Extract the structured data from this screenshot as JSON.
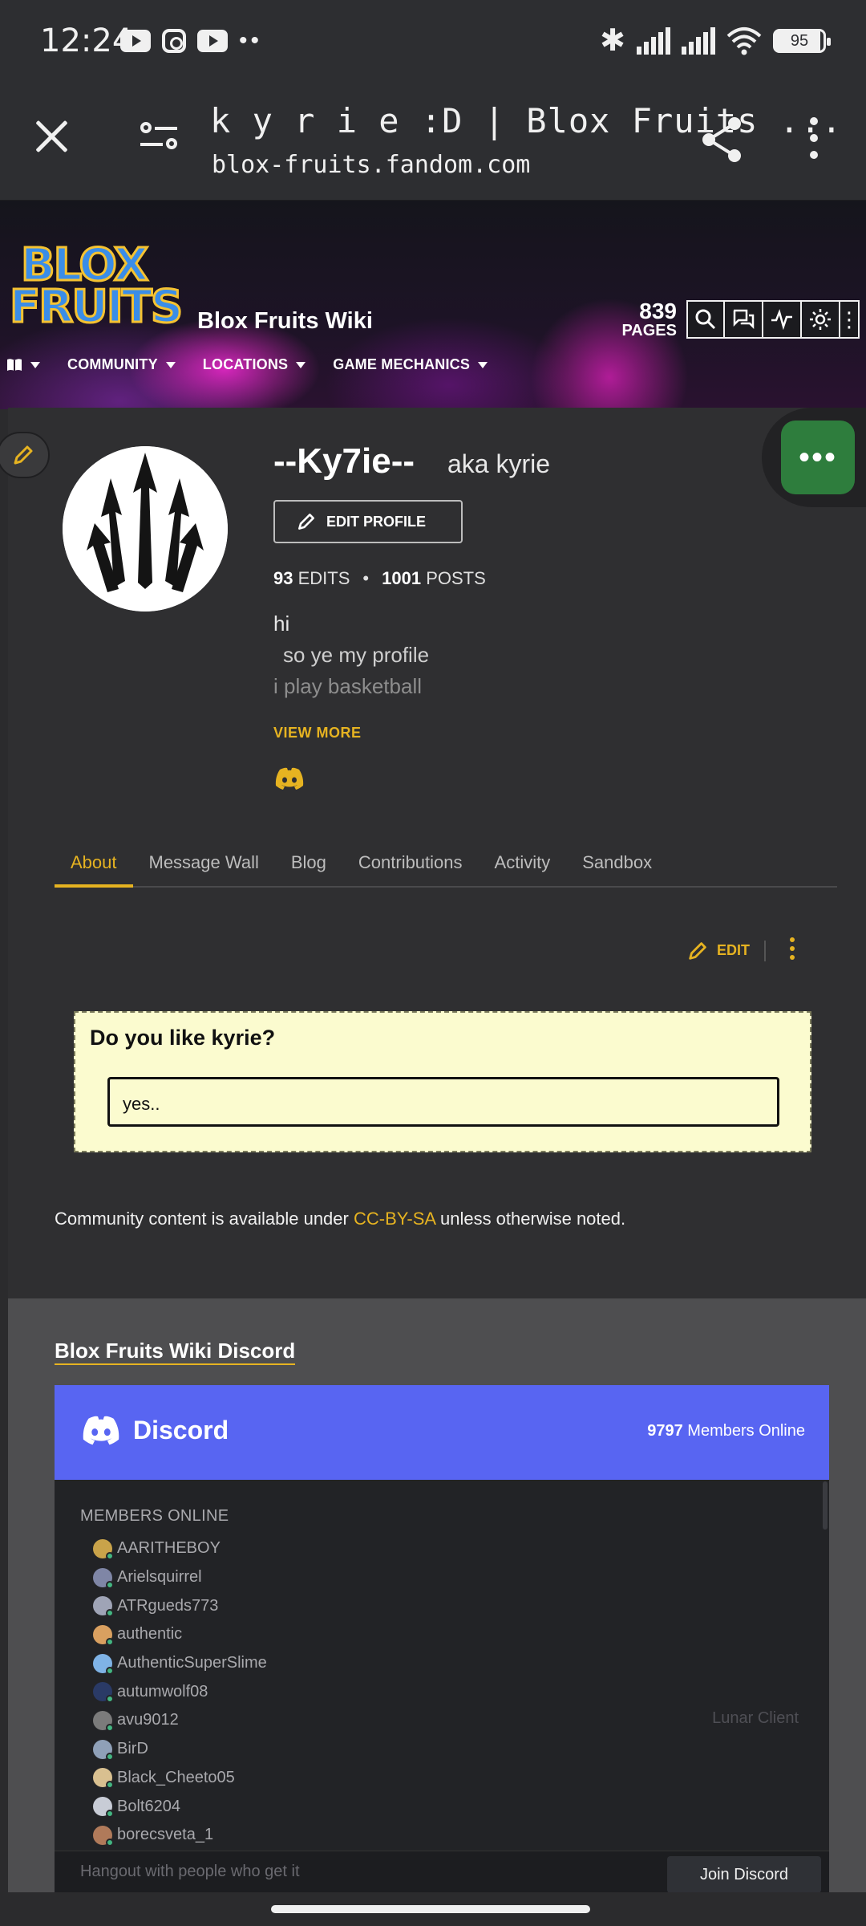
{
  "status_bar": {
    "time": "12:24",
    "battery": "95",
    "icons": [
      "youtube-icon",
      "instagram-icon",
      "youtube-icon",
      "more-dots-icon",
      "bluetooth-icon",
      "signal-icon",
      "signal-icon",
      "wifi-icon",
      "battery-icon"
    ]
  },
  "browser": {
    "title": "k y r i e :D | Blox Fruits ...",
    "url": "blox-fruits.fandom.com"
  },
  "wiki": {
    "logo_line1": "BLOX",
    "logo_line2": "FRUITS",
    "name": "Blox Fruits Wiki",
    "pages_count": "839",
    "pages_label": "PAGES",
    "nav": [
      {
        "label": ""
      },
      {
        "label": "COMMUNITY"
      },
      {
        "label": "LOCATIONS"
      },
      {
        "label": "GAME MECHANICS"
      }
    ]
  },
  "profile": {
    "username": "--Ky7ie--",
    "aka": "aka kyrie",
    "edit_profile_label": "EDIT PROFILE",
    "edits_count": "93",
    "edits_label": "EDITS",
    "stats_sep": "•",
    "posts_count": "1001",
    "posts_label": "POSTS",
    "bio_line1": "hi",
    "bio_line2": "so ye my profile",
    "bio_line3": "i play basketball",
    "view_more_label": "VIEW MORE",
    "tabs": [
      {
        "label": "About"
      },
      {
        "label": "Message Wall"
      },
      {
        "label": "Blog"
      },
      {
        "label": "Contributions"
      },
      {
        "label": "Activity"
      },
      {
        "label": "Sandbox"
      }
    ],
    "edit_label": "EDIT",
    "poll": {
      "question": "Do you like kyrie?",
      "answer": "yes.."
    },
    "license_prefix": "Community content is available under ",
    "license_link": "CC-BY-SA",
    "license_suffix": " unless otherwise noted."
  },
  "discord": {
    "section_title": "Blox Fruits Wiki Discord",
    "brand": "Discord",
    "online_count": "9797",
    "online_label": "Members Online",
    "members_label": "MEMBERS ONLINE",
    "members": [
      {
        "name": "AARITHEBOY",
        "color": "#c9a34a"
      },
      {
        "name": "Arielsquirrel",
        "color": "#7f86a6"
      },
      {
        "name": "ATRgueds773",
        "color": "#9fa4b6"
      },
      {
        "name": "authentic",
        "color": "#d9a060"
      },
      {
        "name": "AuthenticSuperSlime",
        "color": "#7fb3e6"
      },
      {
        "name": "autumwolf08",
        "color": "#2a3a66"
      },
      {
        "name": "avu9012",
        "color": "#7b7b7b"
      },
      {
        "name": "BirD",
        "color": "#8fa0b8"
      },
      {
        "name": "Black_Cheeto05",
        "color": "#d9c090"
      },
      {
        "name": "Bolt6204",
        "color": "#c8ccd6"
      },
      {
        "name": "borecsveta_1",
        "color": "#b07a5a"
      }
    ],
    "game_label": "Lunar Client",
    "footer_text": "Hangout with people who get it",
    "join_label": "Join Discord"
  },
  "colors": {
    "accent": "#e6b321",
    "discord_blurple": "#5865f2",
    "float_button_green": "#2e7d3d",
    "poll_background": "#fbfbcf"
  }
}
